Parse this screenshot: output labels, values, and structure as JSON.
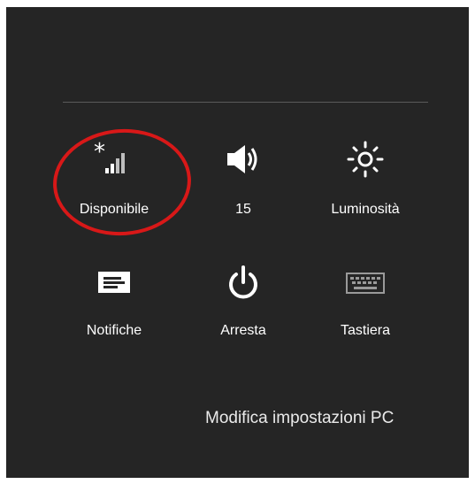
{
  "quick_settings": [
    {
      "id": "network",
      "label": "Disponibile",
      "icon": "network-signal-icon"
    },
    {
      "id": "volume",
      "label": "15",
      "icon": "speaker-volume-icon"
    },
    {
      "id": "brightness",
      "label": "Luminosità",
      "icon": "brightness-sun-icon"
    },
    {
      "id": "notifications",
      "label": "Notifiche",
      "icon": "notifications-icon"
    },
    {
      "id": "power",
      "label": "Arresta",
      "icon": "power-icon"
    },
    {
      "id": "keyboard",
      "label": "Tastiera",
      "icon": "keyboard-icon"
    }
  ],
  "footer": {
    "change_pc_settings": "Modifica impostazioni PC"
  },
  "colors": {
    "panel_bg": "#252525",
    "text": "#ffffff",
    "annotation": "#d81818"
  }
}
